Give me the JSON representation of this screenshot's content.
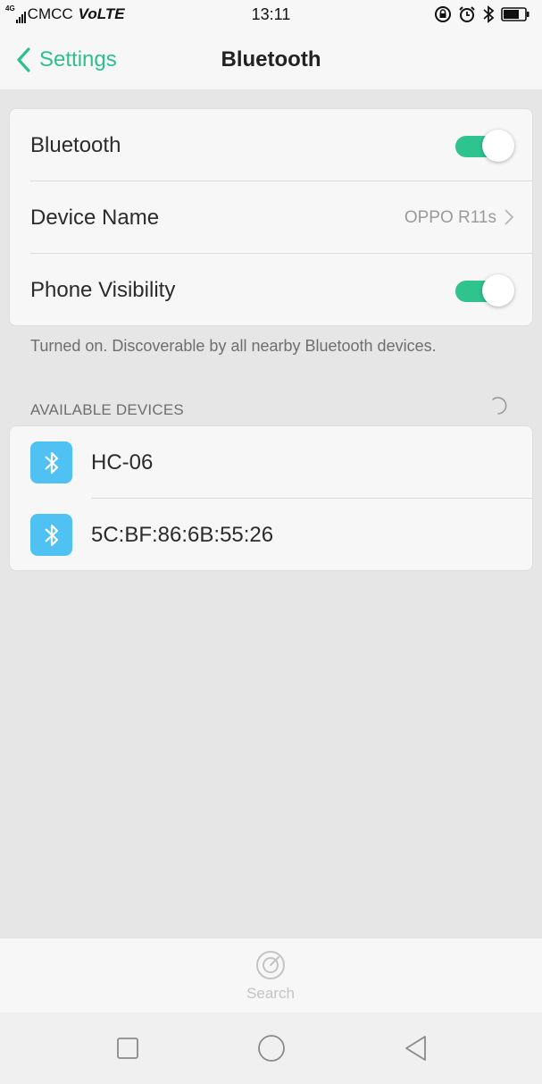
{
  "status_bar": {
    "network": "4G",
    "carrier": "CMCC",
    "volte": "VoLTE",
    "time": "13:11",
    "icons": [
      "rotation-lock-icon",
      "alarm-icon",
      "bluetooth-icon",
      "battery-icon"
    ]
  },
  "nav": {
    "back_label": "Settings",
    "title": "Bluetooth"
  },
  "settings": {
    "bluetooth_label": "Bluetooth",
    "bluetooth_on": true,
    "device_name_label": "Device Name",
    "device_name_value": "OPPO R11s",
    "visibility_label": "Phone Visibility",
    "visibility_on": true
  },
  "visibility_note": "Turned on. Discoverable by all nearby Bluetooth devices.",
  "available": {
    "header": "AVAILABLE DEVICES",
    "devices": [
      {
        "name": "HC-06"
      },
      {
        "name": "5C:BF:86:6B:55:26"
      }
    ]
  },
  "action_bar": {
    "search_label": "Search"
  },
  "colors": {
    "accent": "#2fbe8f",
    "toggle_on": "#2fc48d",
    "device_icon_bg": "#4fc1f2"
  }
}
